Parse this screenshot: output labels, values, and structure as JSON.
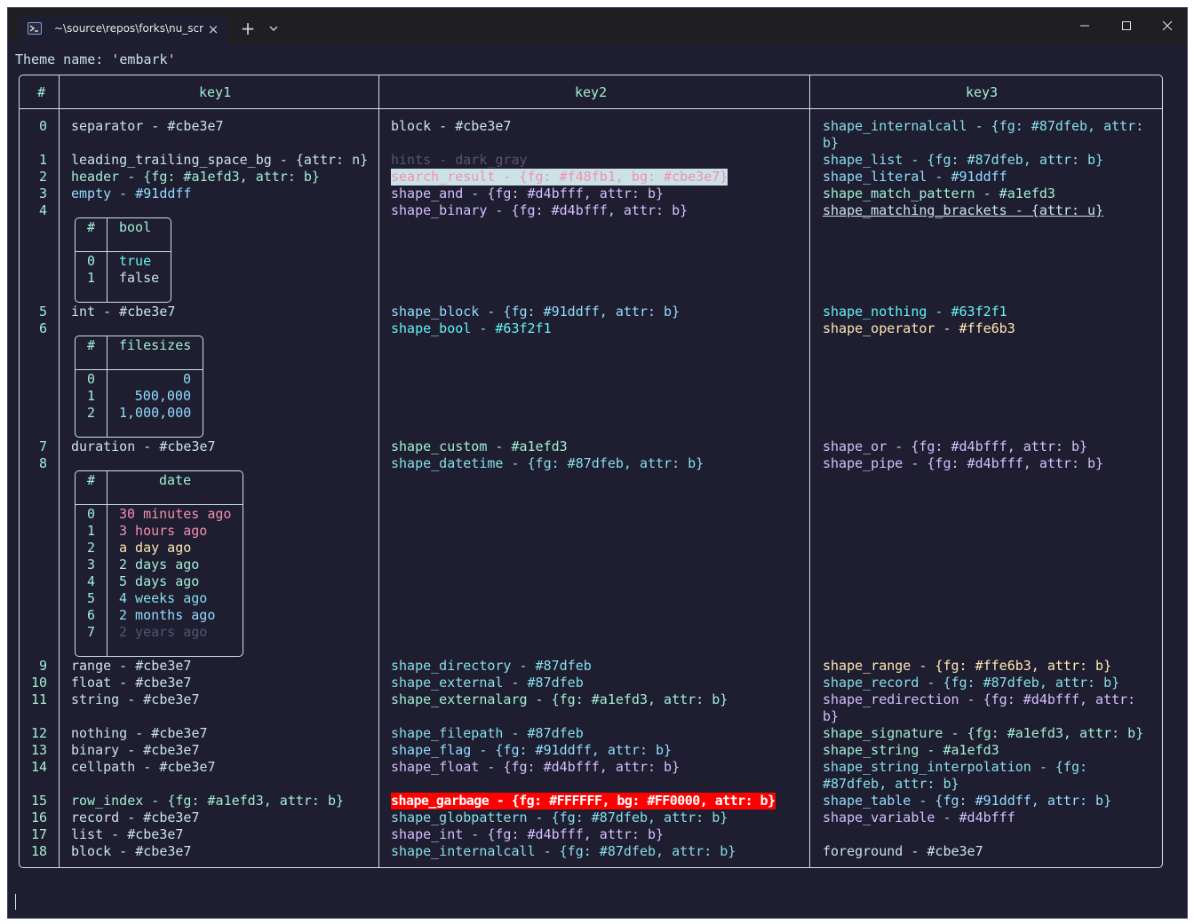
{
  "window": {
    "tab_title": "~\\source\\repos\\forks\\nu_scrip",
    "tab_close_glyph": "×",
    "new_tab_glyph": "+",
    "dropdown_glyph": "⌄"
  },
  "terminal": {
    "heading": "Theme name: 'embark'",
    "columns": [
      "#",
      "key1",
      "key2",
      "key3"
    ],
    "rows": [
      {
        "i": "0",
        "k1": "separator - #cbe3e7",
        "k2": "block - #cbe3e7",
        "k3": "shape_internalcall - {fg: #87dfeb, attr:",
        "k3b": "b}"
      },
      {
        "i": "1",
        "k1": "leading_trailing_space_bg - {attr: n}",
        "k2": "hints - dark_gray",
        "k3": "shape_list - {fg: #87dfeb, attr: b}"
      },
      {
        "i": "2",
        "k1": "header - {fg: #a1efd3, attr: b}",
        "k2": "search_result - {fg: #f48fb1, bg: #cbe3e7}",
        "k3": "shape_literal - #91ddff"
      },
      {
        "i": "3",
        "k1": "empty - #91ddff",
        "k2": "shape_and - {fg: #d4bfff, attr: b}",
        "k3": "shape_match_pattern - #a1efd3"
      },
      {
        "i": "4",
        "k2": "shape_binary - {fg: #d4bfff, attr: b}",
        "k3": "shape_matching_brackets - {attr: u}"
      },
      {
        "i": "5",
        "k1": "int - #cbe3e7",
        "k2": "shape_block - {fg: #91ddff, attr: b}",
        "k3": "shape_nothing - #63f2f1"
      },
      {
        "i": "6",
        "k2": "shape_bool - #63f2f1",
        "k3": "shape_operator - #ffe6b3"
      },
      {
        "i": "7",
        "k1": "duration - #cbe3e7",
        "k2": "shape_custom - #a1efd3",
        "k3": "shape_or - {fg: #d4bfff, attr: b}"
      },
      {
        "i": "8",
        "k2": "shape_datetime - {fg: #87dfeb, attr: b}",
        "k3": "shape_pipe - {fg: #d4bfff, attr: b}"
      },
      {
        "i": "9",
        "k1": "range - #cbe3e7",
        "k2": "shape_directory - #87dfeb",
        "k3": "shape_range - {fg: #ffe6b3, attr: b}"
      },
      {
        "i": "10",
        "k1": "float - #cbe3e7",
        "k2": "shape_external - #87dfeb",
        "k3": "shape_record - {fg: #87dfeb, attr: b}"
      },
      {
        "i": "11",
        "k1": "string - #cbe3e7",
        "k2": "shape_externalarg - {fg: #a1efd3, attr: b}",
        "k3": "shape_redirection - {fg: #d4bfff, attr:",
        "k3b": "b}"
      },
      {
        "i": "12",
        "k1": "nothing - #cbe3e7",
        "k2": "shape_filepath - #87dfeb",
        "k3": "shape_signature - {fg: #a1efd3, attr: b}"
      },
      {
        "i": "13",
        "k1": "binary - #cbe3e7",
        "k2": "shape_flag - {fg: #91ddff, attr: b}",
        "k3": "shape_string - #a1efd3"
      },
      {
        "i": "14",
        "k1": "cellpath - #cbe3e7",
        "k2": "shape_float - {fg: #d4bfff, attr: b}",
        "k3": "shape_string_interpolation - {fg:",
        "k3b": "#87dfeb, attr: b}"
      },
      {
        "i": "15",
        "k1": "row_index - {fg: #a1efd3, attr: b}",
        "k2": "shape_garbage - {fg: #FFFFFF, bg: #FF0000, attr: b}",
        "k3": "shape_table - {fg: #91ddff, attr: b}"
      },
      {
        "i": "16",
        "k1": "record - #cbe3e7",
        "k2": "shape_globpattern - {fg: #87dfeb, attr: b}",
        "k3": "shape_variable - #d4bfff"
      },
      {
        "i": "17",
        "k1": "list - #cbe3e7",
        "k2": "shape_int - {fg: #d4bfff, attr: b}"
      },
      {
        "i": "18",
        "k1": "block - #cbe3e7",
        "k2": "shape_internalcall - {fg: #87dfeb, attr: b}",
        "k3": "foreground - #cbe3e7"
      }
    ],
    "bool_table": {
      "headers": [
        "#",
        "bool"
      ],
      "rows": [
        [
          "0",
          "true"
        ],
        [
          "1",
          "false"
        ]
      ]
    },
    "filesize_table": {
      "headers": [
        "#",
        "filesizes"
      ],
      "rows": [
        [
          "0",
          "0"
        ],
        [
          "1",
          "500,000"
        ],
        [
          "2",
          "1,000,000"
        ]
      ]
    },
    "date_table": {
      "headers": [
        "#",
        "date"
      ],
      "rows": [
        [
          "0",
          "30 minutes ago"
        ],
        [
          "1",
          "3 hours ago"
        ],
        [
          "2",
          "a day ago"
        ],
        [
          "3",
          "2 days ago"
        ],
        [
          "4",
          "5 days ago"
        ],
        [
          "5",
          "4 weeks ago"
        ],
        [
          "6",
          "2 months ago"
        ],
        [
          "7",
          "2 years ago"
        ]
      ]
    }
  },
  "colors": {
    "background": "#1e1e30",
    "titlebar": "#1f1f21",
    "foreground": "#cbe3e7",
    "index": "#a1efd3",
    "string": "#a1efd3",
    "hints": "#585273",
    "search_fg": "#f48fb1",
    "search_bg": "#cbe3e7",
    "shape_garbage_bg": "#FF0000",
    "ffe6b3": "#ffe6b3",
    "d4bfff": "#d4bfff",
    "87dfeb": "#87dfeb",
    "91ddff": "#91ddff",
    "63f2f1": "#63f2f1"
  }
}
